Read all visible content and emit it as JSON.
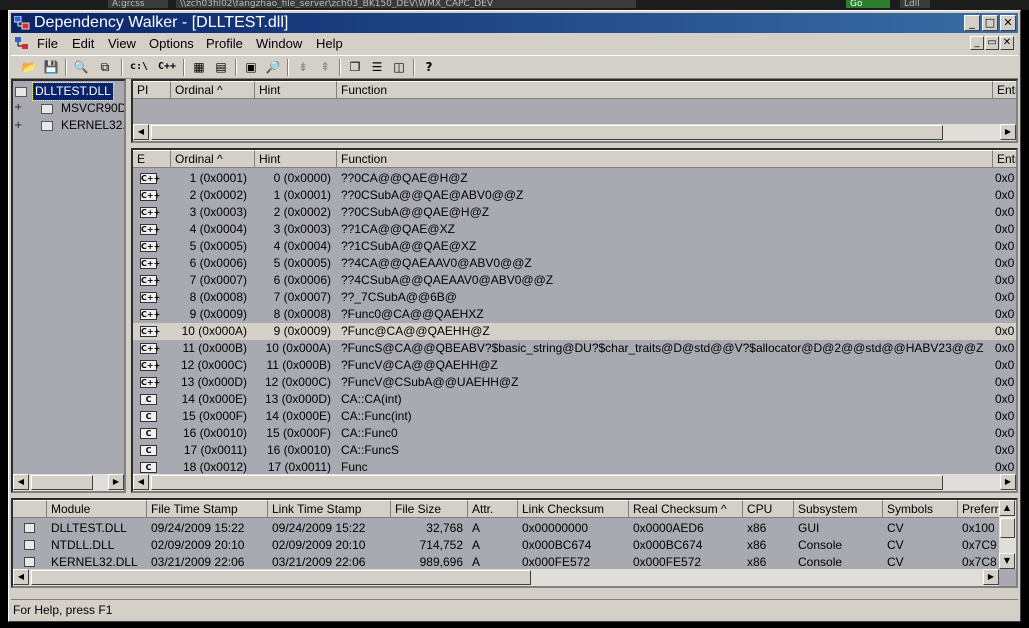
{
  "taskbar": {
    "items": [
      "A:grcss",
      "\\\\zch03fil02\\fangzhao_file_server\\zch03_BK150_DEV\\WMX_CAPC_DEV",
      "Go",
      "Ldll"
    ]
  },
  "window": {
    "title": "Dependency Walker - [DLLTEST.dll]",
    "buttons": {
      "minimize": "_",
      "maximize": "□",
      "close": "✕"
    },
    "mdi_buttons": {
      "minimize": "_",
      "restore": "▭",
      "close": "✕"
    }
  },
  "menubar": {
    "items": [
      "File",
      "Edit",
      "View",
      "Options",
      "Profile",
      "Window",
      "Help"
    ]
  },
  "toolbar": {
    "buttons": [
      {
        "name": "open-icon",
        "glyph": "📂"
      },
      {
        "name": "save-icon",
        "glyph": "💾"
      },
      {
        "name": "find-icon",
        "glyph": "🔍"
      },
      {
        "name": "copy-icon",
        "glyph": "⧉"
      },
      {
        "name": "full-paths-icon",
        "glyph": "c:\\"
      },
      {
        "name": "undecorate-cpp-icon",
        "glyph": "C++"
      },
      {
        "name": "configure-icon",
        "glyph": "▦"
      },
      {
        "name": "properties-icon",
        "glyph": "▤"
      },
      {
        "name": "view-module-icon",
        "glyph": "▣"
      },
      {
        "name": "external-viewer-icon",
        "glyph": "🔎"
      },
      {
        "name": "expand-all-icon",
        "glyph": "⇟"
      },
      {
        "name": "collapse-all-icon",
        "glyph": "⇞"
      },
      {
        "name": "cascade-icon",
        "glyph": "❐"
      },
      {
        "name": "tile-horizontal-icon",
        "glyph": "☰"
      },
      {
        "name": "tile-vertical-icon",
        "glyph": "◫"
      },
      {
        "name": "help-icon",
        "glyph": "?"
      }
    ]
  },
  "tree": {
    "nodes": [
      {
        "label": "DLLTEST.DLL",
        "selected": true
      },
      {
        "label": "MSVCR90D",
        "selected": false
      },
      {
        "label": "KERNEL32.",
        "selected": false
      }
    ]
  },
  "imports": {
    "columns": [
      "PI",
      "Ordinal ^",
      "Hint",
      "Function",
      "Entr"
    ]
  },
  "exports": {
    "columns": [
      "E",
      "Ordinal ^",
      "Hint",
      "Function",
      "Entry"
    ],
    "rows": [
      {
        "type": "C++",
        "ordinal": "1 (0x0001)",
        "hint": "0 (0x0000)",
        "function": "??0CA@@QAE@H@Z",
        "entry": "0x0"
      },
      {
        "type": "C++",
        "ordinal": "2 (0x0002)",
        "hint": "1 (0x0001)",
        "function": "??0CSubA@@QAE@ABV0@@Z",
        "entry": "0x0"
      },
      {
        "type": "C++",
        "ordinal": "3 (0x0003)",
        "hint": "2 (0x0002)",
        "function": "??0CSubA@@QAE@H@Z",
        "entry": "0x0"
      },
      {
        "type": "C++",
        "ordinal": "4 (0x0004)",
        "hint": "3 (0x0003)",
        "function": "??1CA@@QAE@XZ",
        "entry": "0x0"
      },
      {
        "type": "C++",
        "ordinal": "5 (0x0005)",
        "hint": "4 (0x0004)",
        "function": "??1CSubA@@QAE@XZ",
        "entry": "0x0"
      },
      {
        "type": "C++",
        "ordinal": "6 (0x0006)",
        "hint": "5 (0x0005)",
        "function": "??4CA@@QAEAAV0@ABV0@@Z",
        "entry": "0x0"
      },
      {
        "type": "C++",
        "ordinal": "7 (0x0007)",
        "hint": "6 (0x0006)",
        "function": "??4CSubA@@QAEAAV0@ABV0@@Z",
        "entry": "0x0"
      },
      {
        "type": "C++",
        "ordinal": "8 (0x0008)",
        "hint": "7 (0x0007)",
        "function": "??_7CSubA@@6B@",
        "entry": "0x0"
      },
      {
        "type": "C++",
        "ordinal": "9 (0x0009)",
        "hint": "8 (0x0008)",
        "function": "?Func0@CA@@QAEHXZ",
        "entry": "0x0"
      },
      {
        "type": "C++",
        "ordinal": "10 (0x000A)",
        "hint": "9 (0x0009)",
        "function": "?Func@CA@@QAEHH@Z",
        "entry": "0x0",
        "selected": true
      },
      {
        "type": "C++",
        "ordinal": "11 (0x000B)",
        "hint": "10 (0x000A)",
        "function": "?FuncS@CA@@QBEABV?$basic_string@DU?$char_traits@D@std@@V?$allocator@D@2@@std@@HABV23@@Z",
        "entry": "0x0"
      },
      {
        "type": "C++",
        "ordinal": "12 (0x000C)",
        "hint": "11 (0x000B)",
        "function": "?FuncV@CA@@QAEHH@Z",
        "entry": "0x0"
      },
      {
        "type": "C++",
        "ordinal": "13 (0x000D)",
        "hint": "12 (0x000C)",
        "function": "?FuncV@CSubA@@UAEHH@Z",
        "entry": "0x0"
      },
      {
        "type": "C",
        "ordinal": "14 (0x000E)",
        "hint": "13 (0x000D)",
        "function": "CA::CA(int)",
        "entry": "0x0"
      },
      {
        "type": "C",
        "ordinal": "15 (0x000F)",
        "hint": "14 (0x000E)",
        "function": "CA::Func(int)",
        "entry": "0x0"
      },
      {
        "type": "C",
        "ordinal": "16 (0x0010)",
        "hint": "15 (0x000F)",
        "function": "CA::Func0",
        "entry": "0x0"
      },
      {
        "type": "C",
        "ordinal": "17 (0x0011)",
        "hint": "16 (0x0010)",
        "function": "CA::FuncS",
        "entry": "0x0"
      },
      {
        "type": "C",
        "ordinal": "18 (0x0012)",
        "hint": "17 (0x0011)",
        "function": "Func",
        "entry": "0x0"
      }
    ]
  },
  "modules": {
    "columns": [
      "Module",
      "File Time Stamp",
      "Link Time Stamp",
      "File Size",
      "Attr.",
      "Link Checksum",
      "Real Checksum ^",
      "CPU",
      "Subsystem",
      "Symbols",
      "Preferr"
    ],
    "rows": [
      {
        "module": "DLLTEST.DLL",
        "file_ts": "09/24/2009 15:22",
        "link_ts": "09/24/2009 15:22",
        "size": "32,768",
        "attr": "A",
        "link_cs": "0x00000000",
        "real_cs": "0x0000AED6",
        "cpu": "x86",
        "subsystem": "GUI",
        "symbols": "CV",
        "pref": "0x100"
      },
      {
        "module": "NTDLL.DLL",
        "file_ts": "02/09/2009 20:10",
        "link_ts": "02/09/2009 20:10",
        "size": "714,752",
        "attr": "A",
        "link_cs": "0x000BC674",
        "real_cs": "0x000BC674",
        "cpu": "x86",
        "subsystem": "Console",
        "symbols": "CV",
        "pref": "0x7C9"
      },
      {
        "module": "KERNEL32.DLL",
        "file_ts": "03/21/2009 22:06",
        "link_ts": "03/21/2009 22:06",
        "size": "989,696",
        "attr": "A",
        "link_cs": "0x000FE572",
        "real_cs": "0x000FE572",
        "cpu": "x86",
        "subsystem": "Console",
        "symbols": "CV",
        "pref": "0x7C8"
      }
    ]
  },
  "statusbar": {
    "text": "For Help, press F1"
  }
}
